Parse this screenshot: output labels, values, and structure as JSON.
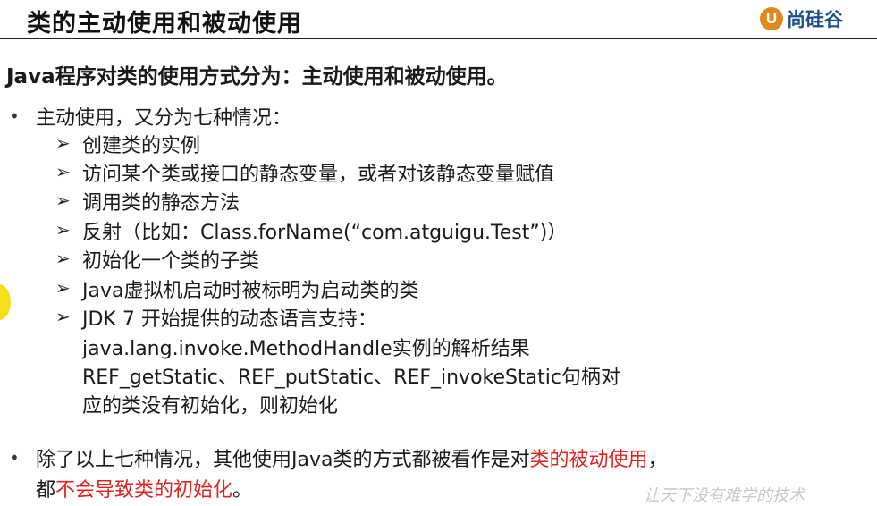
{
  "header": {
    "title": "类的主动使用和被动使用",
    "logo_mark": "U",
    "logo_text": "尚硅谷"
  },
  "content": {
    "lead": "Java程序对类的使用方式分为：主动使用和被动使用。",
    "active": {
      "bullet": "主动使用，又分为七种情况：",
      "items": [
        "创建类的实例",
        "访问某个类或接口的静态变量，或者对该静态变量赋值",
        "调用类的静态方法",
        "反射（比如：Class.forName(“com.atguigu.Test”)）",
        "初始化一个类的子类",
        "Java虚拟机启动时被标明为启动类的类",
        "JDK 7 开始提供的动态语言支持："
      ],
      "item7_cont": [
        "java.lang.invoke.MethodHandle实例的解析结果",
        "REF_getStatic、REF_putStatic、REF_invokeStatic句柄对",
        "应的类没有初始化，则初始化"
      ]
    },
    "passive": {
      "line1_prefix": "除了以上七种情况，其他使用Java类的方式都被看作是对",
      "line1_highlight": "类的被动使用",
      "line1_suffix": "，",
      "line2_prefix": "都",
      "line2_highlight": "不会导致类的初始化",
      "line2_suffix": "。"
    }
  },
  "watermark": "让天下没有难学的技术",
  "colors": {
    "highlight": "#e0241f",
    "logo_orange": "#e08a1e",
    "logo_blue": "#1d4f8f"
  }
}
